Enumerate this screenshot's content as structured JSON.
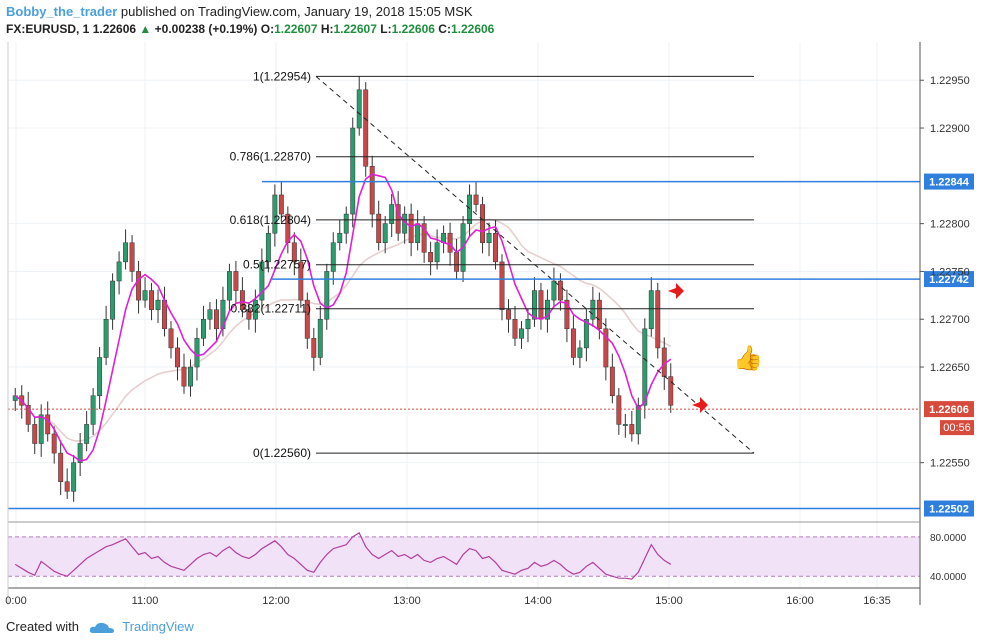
{
  "header": {
    "user": "Bobby_the_trader",
    "published": "published on TradingView.com, January 19, 2018 15:05 MSK"
  },
  "symbol": {
    "name": "FX:EURUSD, 1",
    "price": "1.22606",
    "change": "+0.00238 (+0.19%)",
    "ohlc_o_label": "O:",
    "ohlc_o": "1.22607",
    "ohlc_h_label": "H:",
    "ohlc_h": "1.22607",
    "ohlc_l_label": "L:",
    "ohlc_l": "1.22606",
    "ohlc_c_label": "C:",
    "ohlc_c": "1.22606"
  },
  "footer": {
    "created_with": "Created with",
    "brand": "TradingView"
  },
  "colors": {
    "bull": "#2a9d6e",
    "bear": "#c8484a",
    "ma_fast": "#e21ed6",
    "ma_slow": "#e6cfcf",
    "level_line": "#2f7fdf",
    "fib_line": "#222222",
    "price_tag": "#d64b3c",
    "rsi_line": "#b0409c",
    "rsi_band": "#f2e2f8",
    "grid": "#eef2f6",
    "arrow": "#e61b1b"
  },
  "chart_data": {
    "type": "candlestick",
    "ylim": [
      1.2249,
      1.2299
    ],
    "y_ticks": [
      "1.22950",
      "1.22900",
      "1.22800",
      "1.22750",
      "1.22700",
      "1.22650",
      "1.22550"
    ],
    "x_ticks": [
      "0:00",
      "11:00",
      "12:00",
      "13:00",
      "14:00",
      "15:00",
      "16:00",
      "16:35"
    ],
    "horizontal_levels": [
      {
        "label": "1.22844",
        "value": 1.22844
      },
      {
        "label": "1.22742",
        "value": 1.22742
      },
      {
        "label": "1.22502",
        "value": 1.22502
      }
    ],
    "last_price": {
      "label": "1.22606",
      "value": 1.22606,
      "countdown": "00:56"
    },
    "fibonacci": [
      {
        "label": "1(1.22954)",
        "value": 1.22954
      },
      {
        "label": "0.786(1.22870)",
        "value": 1.2287
      },
      {
        "label": "0.618(1.22804)",
        "value": 1.22804
      },
      {
        "label": "0.5(1.22757)",
        "value": 1.22757
      },
      {
        "label": "0.382(1.22711)",
        "value": 1.22711
      },
      {
        "label": "0(1.22560)",
        "value": 1.2256
      }
    ],
    "trendline": {
      "from": 1.22954,
      "to": 1.2256
    },
    "close": [
      1.2262,
      1.2261,
      1.2259,
      1.2257,
      1.226,
      1.2258,
      1.2256,
      1.2253,
      1.2252,
      1.2255,
      1.2257,
      1.2259,
      1.2262,
      1.2266,
      1.227,
      1.2274,
      1.2276,
      1.2278,
      1.2275,
      1.2272,
      1.2273,
      1.2271,
      1.2272,
      1.2269,
      1.2267,
      1.2265,
      1.2263,
      1.2265,
      1.2268,
      1.227,
      1.2271,
      1.2269,
      1.2272,
      1.2275,
      1.2273,
      1.2271,
      1.227,
      1.2272,
      1.2276,
      1.2279,
      1.2283,
      1.2281,
      1.2278,
      1.2276,
      1.2272,
      1.2268,
      1.2266,
      1.227,
      1.2275,
      1.2278,
      1.2279,
      1.2281,
      1.229,
      1.2294,
      1.2286,
      1.2281,
      1.2278,
      1.228,
      1.2282,
      1.2279,
      1.2281,
      1.2278,
      1.228,
      1.2277,
      1.2276,
      1.2278,
      1.2279,
      1.2277,
      1.2275,
      1.228,
      1.2283,
      1.2282,
      1.2278,
      1.2279,
      1.2276,
      1.2271,
      1.227,
      1.2268,
      1.2269,
      1.227,
      1.2273,
      1.227,
      1.2272,
      1.2274,
      1.2272,
      1.2269,
      1.2266,
      1.2267,
      1.227,
      1.2272,
      1.2269,
      1.2265,
      1.2262,
      1.2259,
      1.2259,
      1.2258,
      1.2261,
      1.2269,
      1.2273,
      1.2267,
      1.2264,
      1.2261
    ],
    "rsi": {
      "labels": [
        "80.0000",
        "40.0000"
      ],
      "upper": 80,
      "lower": 40,
      "values": [
        52,
        48,
        44,
        41,
        55,
        50,
        45,
        42,
        40,
        46,
        52,
        58,
        62,
        66,
        70,
        72,
        75,
        78,
        70,
        62,
        64,
        58,
        60,
        54,
        50,
        48,
        46,
        52,
        58,
        62,
        64,
        60,
        66,
        70,
        64,
        60,
        58,
        62,
        68,
        72,
        76,
        70,
        62,
        58,
        52,
        46,
        44,
        54,
        62,
        68,
        70,
        72,
        80,
        84,
        70,
        62,
        58,
        62,
        66,
        60,
        62,
        58,
        62,
        56,
        54,
        58,
        60,
        56,
        52,
        62,
        68,
        66,
        58,
        60,
        54,
        46,
        44,
        42,
        46,
        48,
        54,
        50,
        52,
        56,
        52,
        46,
        42,
        44,
        50,
        54,
        48,
        42,
        40,
        38,
        38,
        37,
        44,
        58,
        72,
        62,
        56,
        52
      ]
    }
  }
}
